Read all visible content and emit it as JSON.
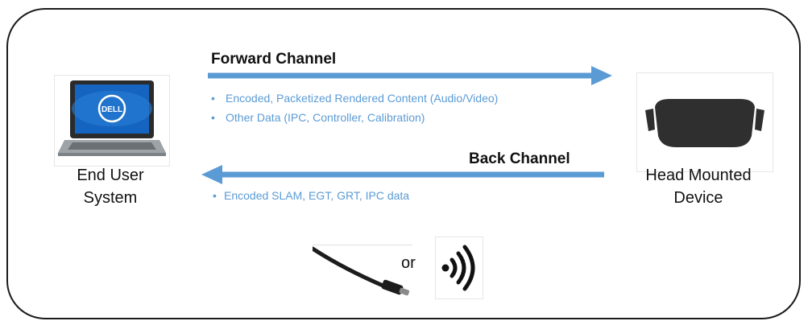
{
  "forward": {
    "title": "Forward Channel",
    "bullets": [
      "Encoded, Packetized Rendered Content (Audio/Video)",
      "Other Data (IPC, Controller, Calibration)"
    ]
  },
  "back": {
    "title": "Back Channel",
    "bullets": [
      "Encoded SLAM, EGT, GRT, IPC data"
    ]
  },
  "end_user": {
    "line1": "End User",
    "line2": "System",
    "screen_logo": "DELL"
  },
  "hmd": {
    "line1": "Head Mounted",
    "line2": "Device"
  },
  "connection": {
    "or_text": "or"
  },
  "colors": {
    "arrow": "#5b9bd5",
    "bullet_text": "#5b9bd5",
    "frame": "#1a1a1a"
  }
}
